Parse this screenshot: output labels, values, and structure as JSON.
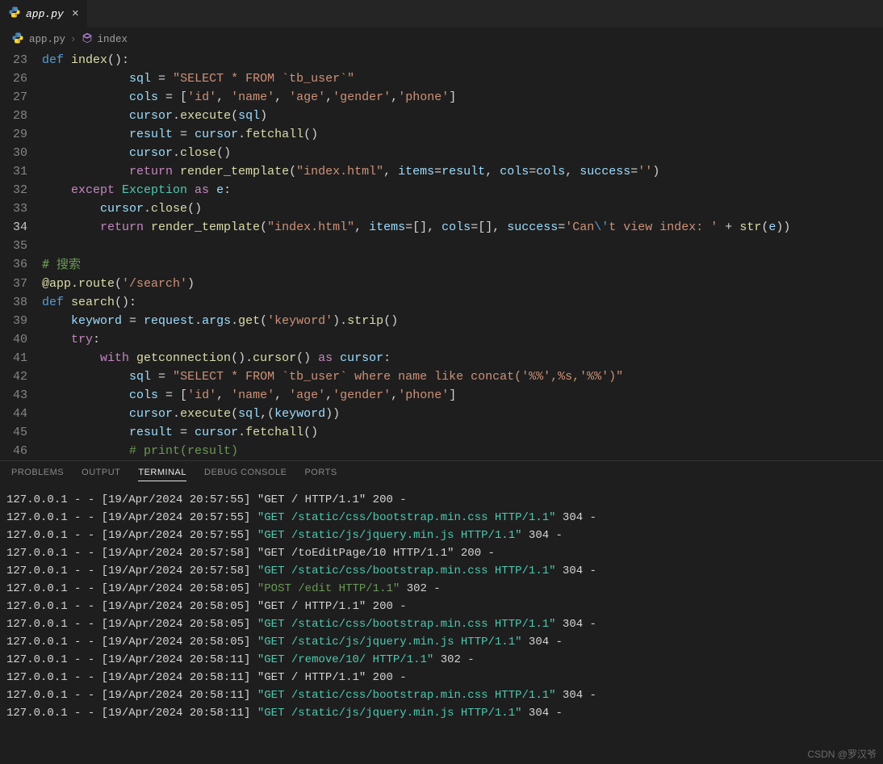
{
  "tab": {
    "filename": "app.py",
    "active": true
  },
  "breadcrumbs": {
    "file": "app.py",
    "symbol": "index"
  },
  "code_lines": [
    {
      "num": 23,
      "tokens": [
        [
          "kw",
          "def "
        ],
        [
          "fn",
          "index"
        ],
        [
          "op",
          "():"
        ]
      ]
    },
    {
      "num": 26,
      "indent": 4,
      "tokens": [
        [
          "var",
          "sql"
        ],
        [
          "op",
          " = "
        ],
        [
          "str",
          "\"SELECT * FROM `tb_user`\""
        ]
      ]
    },
    {
      "num": 27,
      "indent": 4,
      "tokens": [
        [
          "var",
          "cols"
        ],
        [
          "op",
          " = ["
        ],
        [
          "str",
          "'id'"
        ],
        [
          "op",
          ", "
        ],
        [
          "str",
          "'name'"
        ],
        [
          "op",
          ", "
        ],
        [
          "str",
          "'age'"
        ],
        [
          "op",
          ","
        ],
        [
          "str",
          "'gender'"
        ],
        [
          "op",
          ","
        ],
        [
          "str",
          "'phone'"
        ],
        [
          "op",
          "]"
        ]
      ]
    },
    {
      "num": 28,
      "indent": 4,
      "tokens": [
        [
          "var",
          "cursor"
        ],
        [
          "op",
          "."
        ],
        [
          "fn",
          "execute"
        ],
        [
          "op",
          "("
        ],
        [
          "var",
          "sql"
        ],
        [
          "op",
          ")"
        ]
      ]
    },
    {
      "num": 29,
      "indent": 4,
      "tokens": [
        [
          "var",
          "result"
        ],
        [
          "op",
          " = "
        ],
        [
          "var",
          "cursor"
        ],
        [
          "op",
          "."
        ],
        [
          "fn",
          "fetchall"
        ],
        [
          "op",
          "()"
        ]
      ]
    },
    {
      "num": 30,
      "indent": 4,
      "tokens": [
        [
          "var",
          "cursor"
        ],
        [
          "op",
          "."
        ],
        [
          "fn",
          "close"
        ],
        [
          "op",
          "()"
        ]
      ]
    },
    {
      "num": 31,
      "indent": 4,
      "tokens": [
        [
          "kw2",
          "return "
        ],
        [
          "fn",
          "render_template"
        ],
        [
          "op",
          "("
        ],
        [
          "str",
          "\"index.html\""
        ],
        [
          "op",
          ", "
        ],
        [
          "var",
          "items"
        ],
        [
          "op",
          "="
        ],
        [
          "var",
          "result"
        ],
        [
          "op",
          ", "
        ],
        [
          "var",
          "cols"
        ],
        [
          "op",
          "="
        ],
        [
          "var",
          "cols"
        ],
        [
          "op",
          ", "
        ],
        [
          "var",
          "success"
        ],
        [
          "op",
          "="
        ],
        [
          "str",
          "''"
        ],
        [
          "op",
          ")"
        ]
      ]
    },
    {
      "num": 32,
      "indent": 1,
      "tokens": [
        [
          "kw2",
          "except "
        ],
        [
          "cls",
          "Exception"
        ],
        [
          "kw2",
          " as "
        ],
        [
          "var",
          "e"
        ],
        [
          "op",
          ":"
        ]
      ]
    },
    {
      "num": 33,
      "indent": 2,
      "tokens": [
        [
          "var",
          "cursor"
        ],
        [
          "op",
          "."
        ],
        [
          "fn",
          "close"
        ],
        [
          "op",
          "()"
        ]
      ]
    },
    {
      "num": 34,
      "indent": 2,
      "current": true,
      "tokens": [
        [
          "kw2",
          "return "
        ],
        [
          "fn",
          "render_template"
        ],
        [
          "op",
          "("
        ],
        [
          "str",
          "\"index.html\""
        ],
        [
          "op",
          ","
        ],
        [
          "op",
          " "
        ],
        [
          "var",
          "items"
        ],
        [
          "op",
          "=[], "
        ],
        [
          "var",
          "cols"
        ],
        [
          "op",
          "=[], "
        ],
        [
          "var",
          "success"
        ],
        [
          "op",
          "="
        ],
        [
          "str",
          "'Can"
        ],
        [
          "kw",
          "\\'"
        ],
        [
          "str",
          "t view index: '"
        ],
        [
          "op",
          " + "
        ],
        [
          "fn",
          "str"
        ],
        [
          "op",
          "("
        ],
        [
          "var",
          "e"
        ],
        [
          "op",
          "))"
        ]
      ]
    },
    {
      "num": 35,
      "indent": 0,
      "tokens": []
    },
    {
      "num": 36,
      "indent": 0,
      "tokens": [
        [
          "cmtg",
          "# 搜索"
        ]
      ]
    },
    {
      "num": 37,
      "indent": 0,
      "tokens": [
        [
          "fn",
          "@app.route"
        ],
        [
          "op",
          "("
        ],
        [
          "str",
          "'/search'"
        ],
        [
          "op",
          ")"
        ]
      ]
    },
    {
      "num": 38,
      "indent": 0,
      "tokens": [
        [
          "kw",
          "def "
        ],
        [
          "fn",
          "search"
        ],
        [
          "op",
          "():"
        ]
      ]
    },
    {
      "num": 39,
      "indent": 1,
      "tokens": [
        [
          "var",
          "keyword"
        ],
        [
          "op",
          " = "
        ],
        [
          "var",
          "request"
        ],
        [
          "op",
          "."
        ],
        [
          "var",
          "args"
        ],
        [
          "op",
          "."
        ],
        [
          "fn",
          "get"
        ],
        [
          "op",
          "("
        ],
        [
          "str",
          "'keyword'"
        ],
        [
          "op",
          ")."
        ],
        [
          "fn",
          "strip"
        ],
        [
          "op",
          "()"
        ]
      ]
    },
    {
      "num": 40,
      "indent": 1,
      "tokens": [
        [
          "kw2",
          "try"
        ],
        [
          "op",
          ":"
        ]
      ]
    },
    {
      "num": 41,
      "indent": 2,
      "tokens": [
        [
          "kw2",
          "with "
        ],
        [
          "fn",
          "getconnection"
        ],
        [
          "op",
          "()."
        ],
        [
          "fn",
          "cursor"
        ],
        [
          "op",
          "() "
        ],
        [
          "kw2",
          "as "
        ],
        [
          "var",
          "cursor"
        ],
        [
          "op",
          ":"
        ]
      ]
    },
    {
      "num": 42,
      "indent": 4,
      "tokens": [
        [
          "var",
          "sql"
        ],
        [
          "op",
          " = "
        ],
        [
          "str",
          "\"SELECT * FROM `tb_user` where name like concat('%%',%s,'%%')\""
        ]
      ]
    },
    {
      "num": 43,
      "indent": 4,
      "tokens": [
        [
          "var",
          "cols"
        ],
        [
          "op",
          " = ["
        ],
        [
          "str",
          "'id'"
        ],
        [
          "op",
          ", "
        ],
        [
          "str",
          "'name'"
        ],
        [
          "op",
          ", "
        ],
        [
          "str",
          "'age'"
        ],
        [
          "op",
          ","
        ],
        [
          "str",
          "'gender'"
        ],
        [
          "op",
          ","
        ],
        [
          "str",
          "'phone'"
        ],
        [
          "op",
          "]"
        ]
      ]
    },
    {
      "num": 44,
      "indent": 4,
      "tokens": [
        [
          "var",
          "cursor"
        ],
        [
          "op",
          "."
        ],
        [
          "fn",
          "execute"
        ],
        [
          "op",
          "("
        ],
        [
          "var",
          "sql"
        ],
        [
          "op",
          ",("
        ],
        [
          "var",
          "keyword"
        ],
        [
          "op",
          "))"
        ]
      ]
    },
    {
      "num": 45,
      "indent": 4,
      "tokens": [
        [
          "var",
          "result"
        ],
        [
          "op",
          " = "
        ],
        [
          "var",
          "cursor"
        ],
        [
          "op",
          "."
        ],
        [
          "fn",
          "fetchall"
        ],
        [
          "op",
          "()"
        ]
      ]
    },
    {
      "num": 46,
      "indent": 4,
      "tokens": [
        [
          "cmtg",
          "# print(result)"
        ]
      ]
    }
  ],
  "panel_tabs": {
    "problems": "PROBLEMS",
    "output": "OUTPUT",
    "terminal": "TERMINAL",
    "debug_console": "DEBUG CONSOLE",
    "ports": "PORTS",
    "active": "terminal"
  },
  "terminal_lines": [
    {
      "ip": "127.0.0.1",
      "ts": "[19/Apr/2024 20:57:55]",
      "req": "\"GET / HTTP/1.1\"",
      "status": "200 -",
      "style": "plain"
    },
    {
      "ip": "127.0.0.1",
      "ts": "[19/Apr/2024 20:57:55]",
      "req": "\"GET /static/css/bootstrap.min.css HTTP/1.1\"",
      "status": "304 -",
      "style": "teal"
    },
    {
      "ip": "127.0.0.1",
      "ts": "[19/Apr/2024 20:57:55]",
      "req": "\"GET /static/js/jquery.min.js HTTP/1.1\"",
      "status": "304 -",
      "style": "teal"
    },
    {
      "ip": "127.0.0.1",
      "ts": "[19/Apr/2024 20:57:58]",
      "req": "\"GET /toEditPage/10 HTTP/1.1\"",
      "status": "200 -",
      "style": "plain"
    },
    {
      "ip": "127.0.0.1",
      "ts": "[19/Apr/2024 20:57:58]",
      "req": "\"GET /static/css/bootstrap.min.css HTTP/1.1\"",
      "status": "304 -",
      "style": "teal"
    },
    {
      "ip": "127.0.0.1",
      "ts": "[19/Apr/2024 20:58:05]",
      "req": "\"POST /edit HTTP/1.1\"",
      "status": "302 -",
      "style": "green"
    },
    {
      "ip": "127.0.0.1",
      "ts": "[19/Apr/2024 20:58:05]",
      "req": "\"GET / HTTP/1.1\"",
      "status": "200 -",
      "style": "plain"
    },
    {
      "ip": "127.0.0.1",
      "ts": "[19/Apr/2024 20:58:05]",
      "req": "\"GET /static/css/bootstrap.min.css HTTP/1.1\"",
      "status": "304 -",
      "style": "teal"
    },
    {
      "ip": "127.0.0.1",
      "ts": "[19/Apr/2024 20:58:05]",
      "req": "\"GET /static/js/jquery.min.js HTTP/1.1\"",
      "status": "304 -",
      "style": "teal"
    },
    {
      "ip": "127.0.0.1",
      "ts": "[19/Apr/2024 20:58:11]",
      "req": "\"GET /remove/10/ HTTP/1.1\"",
      "status": "302 -",
      "style": "teal"
    },
    {
      "ip": "127.0.0.1",
      "ts": "[19/Apr/2024 20:58:11]",
      "req": "\"GET / HTTP/1.1\"",
      "status": "200 -",
      "style": "plain"
    },
    {
      "ip": "127.0.0.1",
      "ts": "[19/Apr/2024 20:58:11]",
      "req": "\"GET /static/css/bootstrap.min.css HTTP/1.1\"",
      "status": "304 -",
      "style": "teal"
    },
    {
      "ip": "127.0.0.1",
      "ts": "[19/Apr/2024 20:58:11]",
      "req": "\"GET /static/js/jquery.min.js HTTP/1.1\"",
      "status": "304 -",
      "style": "teal"
    }
  ],
  "watermark": "CSDN @罗汉爷"
}
